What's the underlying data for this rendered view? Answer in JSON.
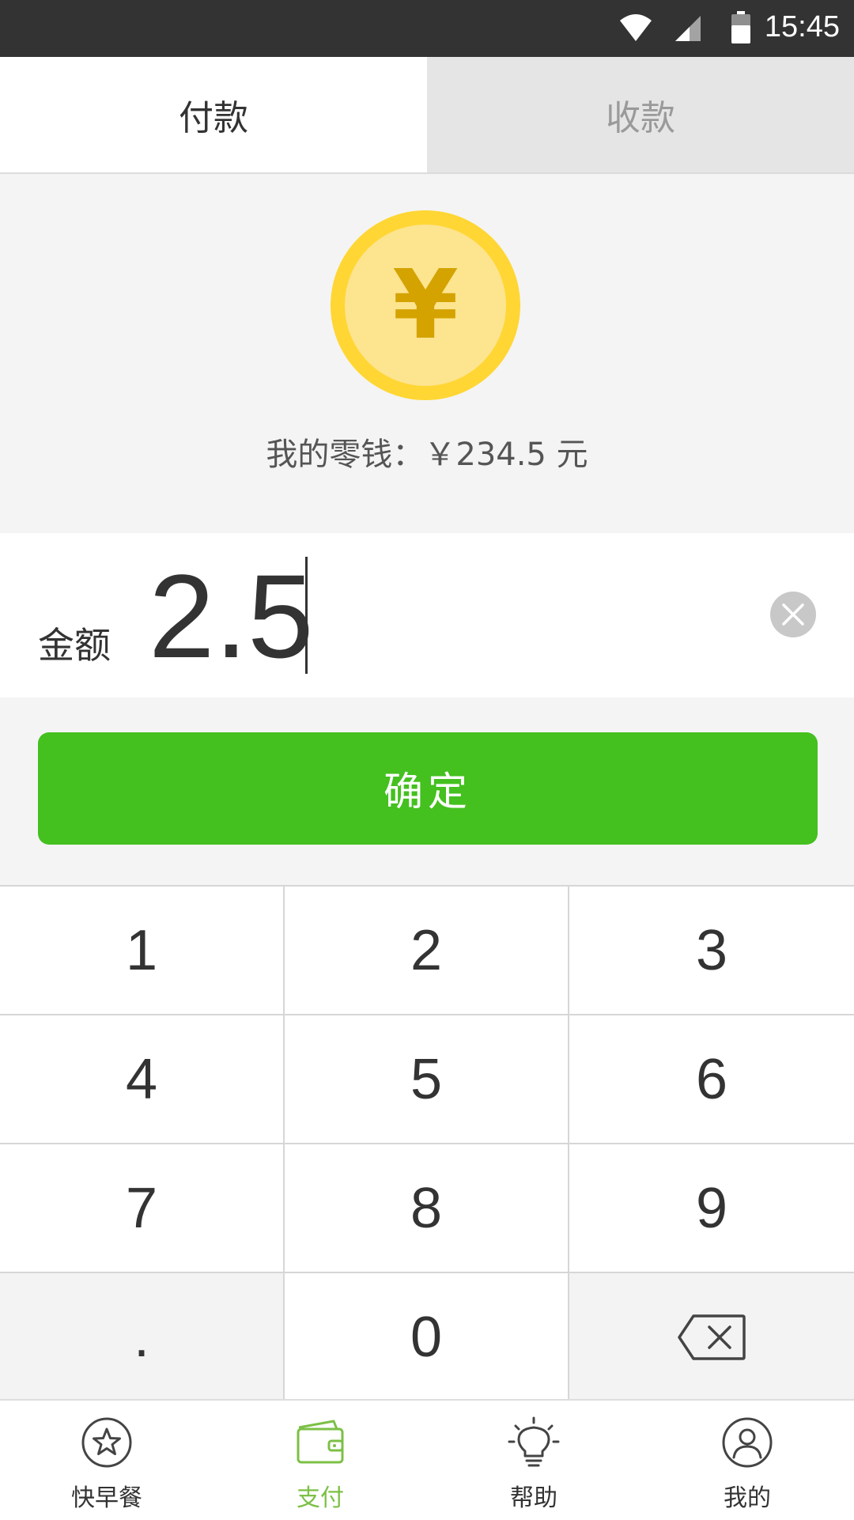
{
  "status_bar": {
    "time": "15:45"
  },
  "tabs": [
    {
      "label": "付款",
      "active": true
    },
    {
      "label": "收款",
      "active": false
    }
  ],
  "wallet": {
    "coin_symbol": "¥",
    "balance_text": "我的零钱：￥234.5 元"
  },
  "amount": {
    "label": "金额",
    "value": "2.5"
  },
  "confirm": {
    "label": "确定"
  },
  "keypad": {
    "keys": [
      "1",
      "2",
      "3",
      "4",
      "5",
      "6",
      "7",
      "8",
      "9",
      ".",
      "0"
    ]
  },
  "bottom_nav": [
    {
      "label": "快早餐",
      "icon": "star-circle-icon"
    },
    {
      "label": "支付",
      "icon": "wallet-icon",
      "active": true
    },
    {
      "label": "帮助",
      "icon": "lightbulb-icon"
    },
    {
      "label": "我的",
      "icon": "user-circle-icon"
    }
  ],
  "colors": {
    "accent_green": "#44c01f",
    "nav_active_green": "#7cc046",
    "coin_gold": "#ffd633",
    "status_bar": "#333333"
  }
}
